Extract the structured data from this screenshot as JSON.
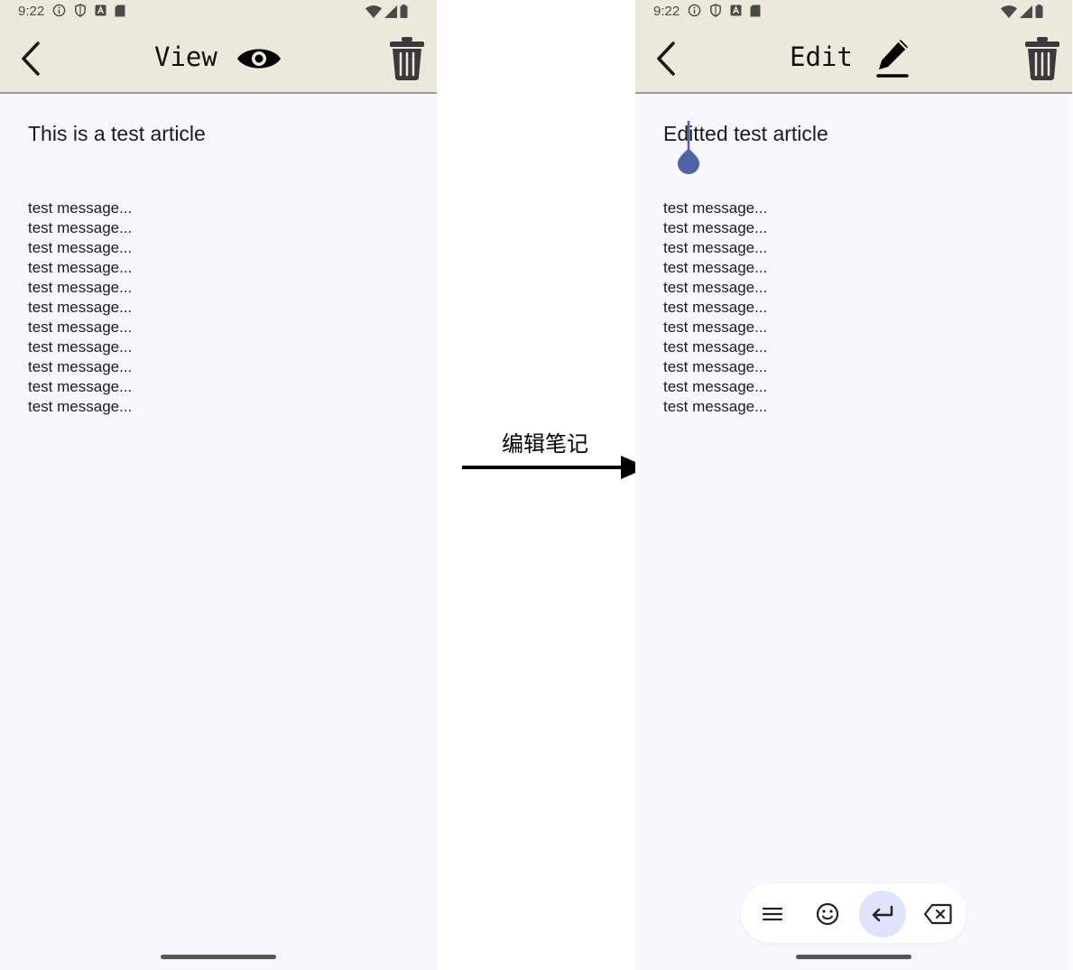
{
  "left_screen": {
    "status": {
      "time": "9:22"
    },
    "app_bar": {
      "title": "View",
      "back_icon": "chevron-left-icon",
      "mode_icon": "eye-icon",
      "delete_icon": "trash-icon"
    },
    "note": {
      "title": "This is a test article",
      "body_lines": [
        "test message...",
        "test message...",
        "test message...",
        "test message...",
        "test message...",
        "test message...",
        "test message...",
        "test message...",
        "test message...",
        "test message...",
        "test message..."
      ]
    }
  },
  "transition": {
    "label": "编辑笔记",
    "arrow_icon": "arrow-right-icon"
  },
  "right_screen": {
    "status": {
      "time": "9:22"
    },
    "app_bar": {
      "title": "Edit",
      "back_icon": "chevron-left-icon",
      "mode_icon": "pencil-icon",
      "delete_icon": "trash-icon"
    },
    "note": {
      "title": "Editted test article",
      "body_lines": [
        "test message...",
        "test message...",
        "test message...",
        "test message...",
        "test message...",
        "test message...",
        "test message...",
        "test message...",
        "test message...",
        "test message...",
        "test message..."
      ]
    },
    "keyboard_toolbar": {
      "buttons": [
        {
          "icon": "menu-icon"
        },
        {
          "icon": "emoji-icon"
        },
        {
          "icon": "enter-icon",
          "active": true
        },
        {
          "icon": "backspace-icon"
        }
      ]
    }
  },
  "colors": {
    "app_bar_bg": "#ece9dc",
    "screen_bg": "#f8f7fd",
    "cursor_handle": "#4f64a8",
    "active_key_bg": "#dfe3fb",
    "icon_dark": "#3a3a3a"
  }
}
